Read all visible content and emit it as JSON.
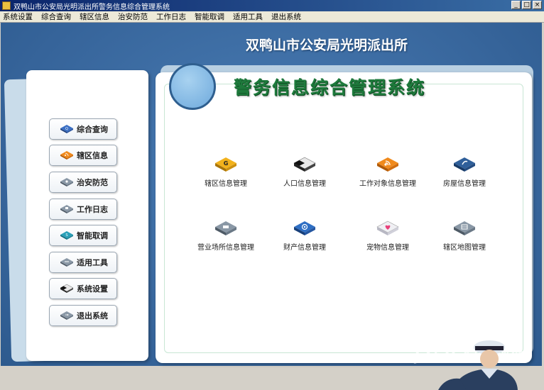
{
  "window": {
    "title": "双鸭山市公安局光明派出所警务信息综合管理系统",
    "buttons": [
      "_",
      "□",
      "×"
    ]
  },
  "menu": [
    "系统设置",
    "综合查询",
    "辖区信息",
    "治安防范",
    "工作日志",
    "智能取调",
    "适用工具",
    "退出系统"
  ],
  "banner": {
    "title": "双鸭山市公安局光明派出所"
  },
  "system_title": "警务信息综合管理系统",
  "sidebar": {
    "items": [
      {
        "label": "综合查询",
        "icon": "query-icon",
        "color": "#3a6fc4"
      },
      {
        "label": "辖区信息",
        "icon": "rss-icon",
        "color": "#f08a1c"
      },
      {
        "label": "治安防范",
        "icon": "security-icon",
        "color": "#7a8a98"
      },
      {
        "label": "工作日志",
        "icon": "log-icon",
        "color": "#7a8a98"
      },
      {
        "label": "智能取调",
        "icon": "smart-icon",
        "color": "#2aa0b8"
      },
      {
        "label": "适用工具",
        "icon": "tools-icon",
        "color": "#7a8a98"
      },
      {
        "label": "系统设置",
        "icon": "settings-icon",
        "color": "#333333"
      },
      {
        "label": "退出系统",
        "icon": "exit-icon",
        "color": "#7a8a98"
      }
    ]
  },
  "modules": {
    "row1": [
      {
        "label": "辖区信息管理",
        "icon": "district-icon",
        "color": "#f2b21c"
      },
      {
        "label": "人口信息管理",
        "icon": "population-icon",
        "color": "#333333"
      },
      {
        "label": "工作对象信息管理",
        "icon": "rss-icon",
        "color": "#f08a1c"
      },
      {
        "label": "房屋信息管理",
        "icon": "house-icon",
        "color": "#2f5f9a"
      }
    ],
    "row2": [
      {
        "label": "营业场所信息管理",
        "icon": "venue-icon",
        "color": "#7a8a98"
      },
      {
        "label": "财产信息管理",
        "icon": "property-icon",
        "color": "#2f6fc4"
      },
      {
        "label": "宠物信息管理",
        "icon": "pet-icon",
        "color": "#e8407a"
      },
      {
        "label": "辖区地图管理",
        "icon": "map-icon",
        "color": "#7a8a98"
      }
    ]
  },
  "watermark": "JZ5U 绿色软件"
}
